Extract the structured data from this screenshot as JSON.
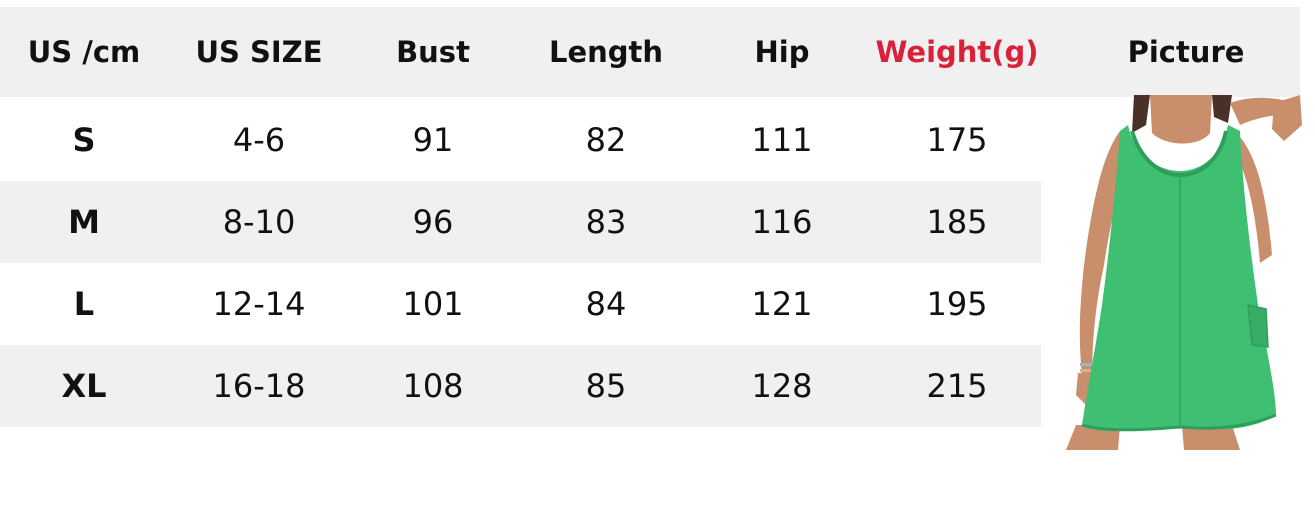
{
  "table": {
    "headers": [
      "US /cm",
      "US SIZE",
      "Bust",
      "Length",
      "Hip",
      "Weight(g)",
      "Picture"
    ],
    "rows": [
      {
        "size": "S",
        "us_size": "4-6",
        "bust": "91",
        "length": "82",
        "hip": "111",
        "weight": "175"
      },
      {
        "size": "M",
        "us_size": "8-10",
        "bust": "96",
        "length": "83",
        "hip": "116",
        "weight": "185"
      },
      {
        "size": "L",
        "us_size": "12-14",
        "bust": "101",
        "length": "84",
        "hip": "121",
        "weight": "195"
      },
      {
        "size": "XL",
        "us_size": "16-18",
        "bust": "108",
        "length": "85",
        "hip": "128",
        "weight": "215"
      }
    ]
  },
  "colors": {
    "header_bg": "#f0f0f0",
    "stripe_bg": "#f0f0f0",
    "weight_header": "#d9223a",
    "garment": "#3fbf72",
    "skin": "#c98e6c",
    "hair": "#4a3026"
  },
  "picture": {
    "subject": "model-wearing-green-romper"
  }
}
